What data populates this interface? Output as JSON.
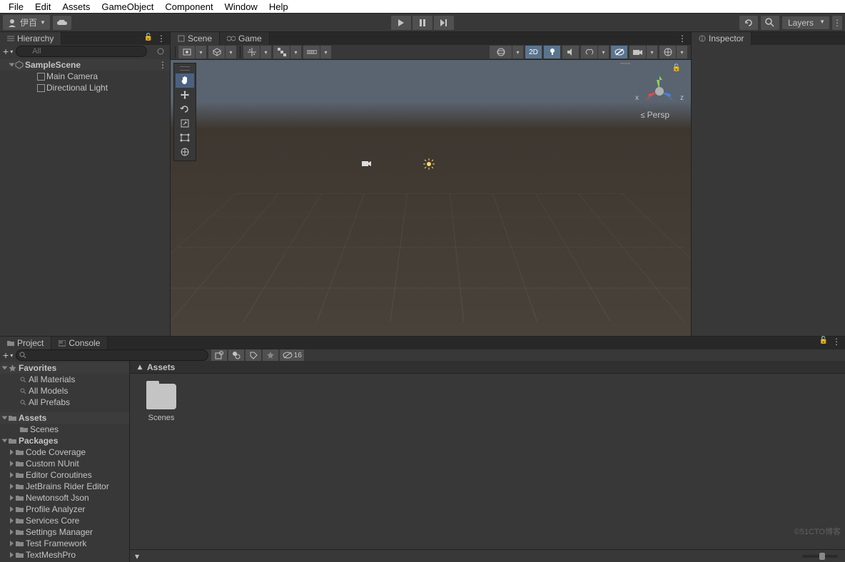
{
  "menubar": [
    "File",
    "Edit",
    "Assets",
    "GameObject",
    "Component",
    "Window",
    "Help"
  ],
  "account": {
    "name": "伊百"
  },
  "toolbar": {
    "layers_label": "Layers"
  },
  "hierarchy": {
    "tab": "Hierarchy",
    "search_placeholder": "All",
    "scene": "SampleScene",
    "items": [
      "Main Camera",
      "Directional Light"
    ]
  },
  "scene": {
    "tab_scene": "Scene",
    "tab_game": "Game",
    "btn_2d": "2D",
    "axis_x": "x",
    "axis_z": "z",
    "persp": "Persp"
  },
  "inspector": {
    "tab": "Inspector"
  },
  "project": {
    "tab_project": "Project",
    "tab_console": "Console",
    "hidden_count": "16",
    "breadcrumb": "Assets",
    "favorites_label": "Favorites",
    "favorites": [
      "All Materials",
      "All Models",
      "All Prefabs"
    ],
    "assets_label": "Assets",
    "assets_children": [
      "Scenes"
    ],
    "packages_label": "Packages",
    "packages": [
      "Code Coverage",
      "Custom NUnit",
      "Editor Coroutines",
      "JetBrains Rider Editor",
      "Newtonsoft Json",
      "Profile Analyzer",
      "Services Core",
      "Settings Manager",
      "Test Framework",
      "TextMeshPro"
    ],
    "grid_item": "Scenes"
  },
  "watermark": "©51CTO博客"
}
